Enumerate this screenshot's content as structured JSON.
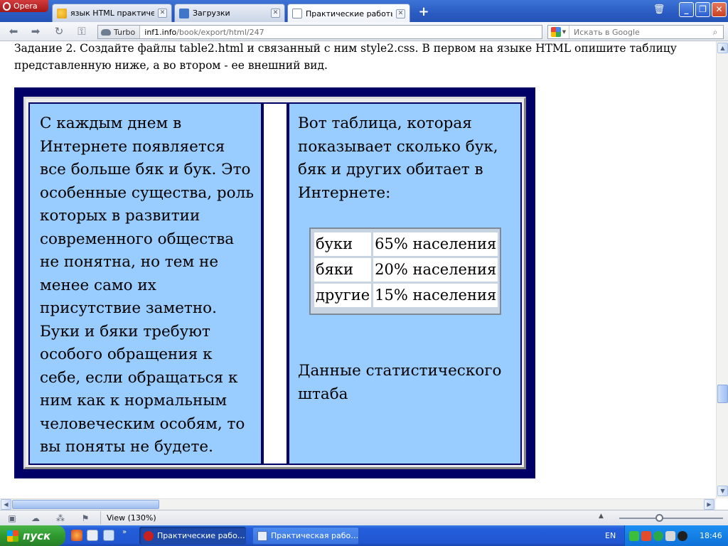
{
  "browser": {
    "menu_label": "Opera",
    "tabs": [
      {
        "label": "язык HTML практическ…",
        "icon": "search-page-icon"
      },
      {
        "label": "Загрузки",
        "icon": "downloads-icon"
      },
      {
        "label": "Практические работы …",
        "icon": "page-icon",
        "active": true
      }
    ],
    "new_tab": "+",
    "window_buttons": {
      "minimize": "_",
      "restore": "❐",
      "close": "✕"
    }
  },
  "navbar": {
    "turbo_label": "Turbo",
    "url_host": "inf1.info",
    "url_path": "/book/export/html/247",
    "search_placeholder": "Искать в Google"
  },
  "page": {
    "task_text": "Задание 2. Создайте файлы table2.html и связанный с ним style2.css. В первом на языке HTML опишите таблицу представленную ниже, а во втором - ее внешний вид.",
    "left_cell_text": "С каждым днем в Интернете появляется все больше бяк и бук. Это особенные существа, роль которых в развитии современного общества не понятна, но тем не менее само их присутствие заметно. Буки и бяки требуют особого обращения к себе, если обращаться к ним как к нормальным человеческим особям, то вы поняты не будете.",
    "right_cell_intro": "Вот таблица, которая показывает сколько бук, бяк и других обитает в Интернете:",
    "stats_rows": [
      {
        "name": "буки",
        "value": "65% населения"
      },
      {
        "name": "бяки",
        "value": "20% населения"
      },
      {
        "name": "другие",
        "value": "15% населения"
      }
    ],
    "right_cell_note": "Данные статистического штаба",
    "colors": {
      "frame": "#000066",
      "cell": "#99ccff"
    }
  },
  "statusbar": {
    "view_label": "View (130%)",
    "zoom_fraction": 0.4
  },
  "taskbar": {
    "start_label": "пуск",
    "tasks": [
      {
        "label": "Практические рабо…",
        "active": true
      },
      {
        "label": "Практическая рабо…",
        "active": false
      }
    ],
    "language": "EN",
    "clock": "18:46"
  }
}
